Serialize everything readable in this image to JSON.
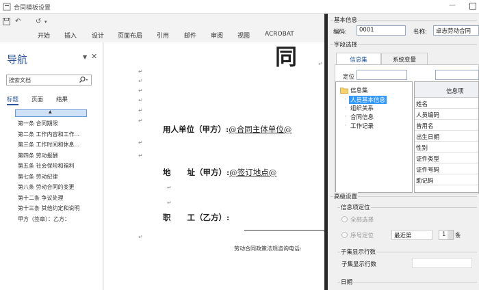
{
  "window": {
    "title": "合同模板设置"
  },
  "ribbon": {
    "quick_undo": "↶",
    "quick_redo": "↺",
    "quick_more": "▾",
    "tabs": [
      "开始",
      "插入",
      "设计",
      "页面布局",
      "引用",
      "邮件",
      "审阅",
      "视图",
      "ACROBAT"
    ]
  },
  "nav": {
    "title": "导航",
    "search_placeholder": "搜索文档",
    "tabs": [
      "标题",
      "页面",
      "结果"
    ],
    "items": [
      "第一条 合同期限",
      "第二条 工作内容和工作...",
      "第三条 工作时间和休息...",
      "第四条 劳动报酬",
      "第五条 社会保险和福利",
      "第七条 劳动纪律",
      "第八条 劳动合同的变更",
      "第十二条 争议处理",
      "第十三条 其他约定和说明",
      "甲方（签章）：乙方："
    ]
  },
  "doc": {
    "big_char": "同",
    "employer_label": "用人单位（甲方）:",
    "employer_field": "@合同主体单位@",
    "address_label_a": "地",
    "address_label_b": "址（甲方）:",
    "address_field": "@签订地点@",
    "employee_label_a": "职",
    "employee_label_b": "工（乙方）:",
    "footer": "劳动合同政策法规咨询电话:",
    "para_mark": "↵"
  },
  "panel": {
    "basic_group": "基本信息",
    "code_label": "编码:",
    "code_value": "0001",
    "name_label": "名称:",
    "name_value": "卓志劳动合同",
    "field_group": "字段选择",
    "tabs": [
      "信息集",
      "系统变量"
    ],
    "locate_label": "定位",
    "tree_root": "信息集",
    "tree_children": [
      "人员基本信息",
      "组织关系",
      "合同信息",
      "工作记录"
    ],
    "grid_header": "信息项",
    "grid_rows": [
      "姓名",
      "人员编码",
      "曾用名",
      "出生日期",
      "性别",
      "证件类型",
      "证件号码",
      "助记码"
    ],
    "adv_group": "高级设置",
    "locate_group": "信息项定位",
    "opt_all": "全部选择",
    "opt_seq": "序号定位",
    "seq_mode": "最近第",
    "seq_num": "1",
    "seq_unit": "条",
    "subset_group": "子集显示行数",
    "subset_label": "子集显示行数",
    "date_group": "日期"
  }
}
